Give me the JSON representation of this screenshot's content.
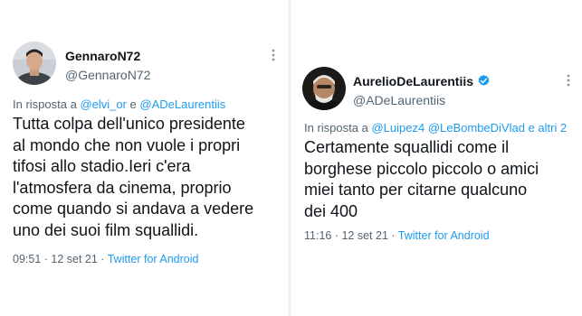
{
  "left_tweet": {
    "display_name": "GennaroN72",
    "handle": "@GennaroN72",
    "reply_prefix": "In risposta a ",
    "reply_mention_1": "@elvi_or",
    "reply_joiner": " e ",
    "reply_mention_2": "@ADeLaurentiis",
    "text": "Tutta colpa dell'unico presidente\nal mondo che non vuole i propri\ntifosi allo stadio.Ieri c'era\nl'atmosfera da cinema, proprio\ncome quando si andava a vedere\nuno dei suoi film squallidi.",
    "time": "09:51",
    "date": "12 set 21",
    "separator": " · ",
    "source": "Twitter for Android",
    "more_icon": "more-dots-icon"
  },
  "right_tweet": {
    "display_name": "AurelioDeLaurentiis",
    "handle": "@ADeLaurentiis",
    "verified_icon": "verified-badge-icon",
    "reply_prefix": "In risposta a ",
    "reply_mention_1": "@Luipez4",
    "reply_joiner": " ",
    "reply_mention_2": "@LeBombeDiVlad",
    "reply_suffix": " e altri 2",
    "text": "Certamente squallidi come il\nborghese piccolo piccolo o amici\nmiei tanto per citarne qualcuno\ndei 400",
    "time": "11:16",
    "date": "12 set 21",
    "separator": " · ",
    "source": "Twitter for Android",
    "more_icon": "more-dots-icon"
  },
  "colors": {
    "link": "#1d9bf0",
    "secondary_text": "#536471",
    "primary_text": "#0f1419",
    "verified": "#1d9bf0"
  }
}
